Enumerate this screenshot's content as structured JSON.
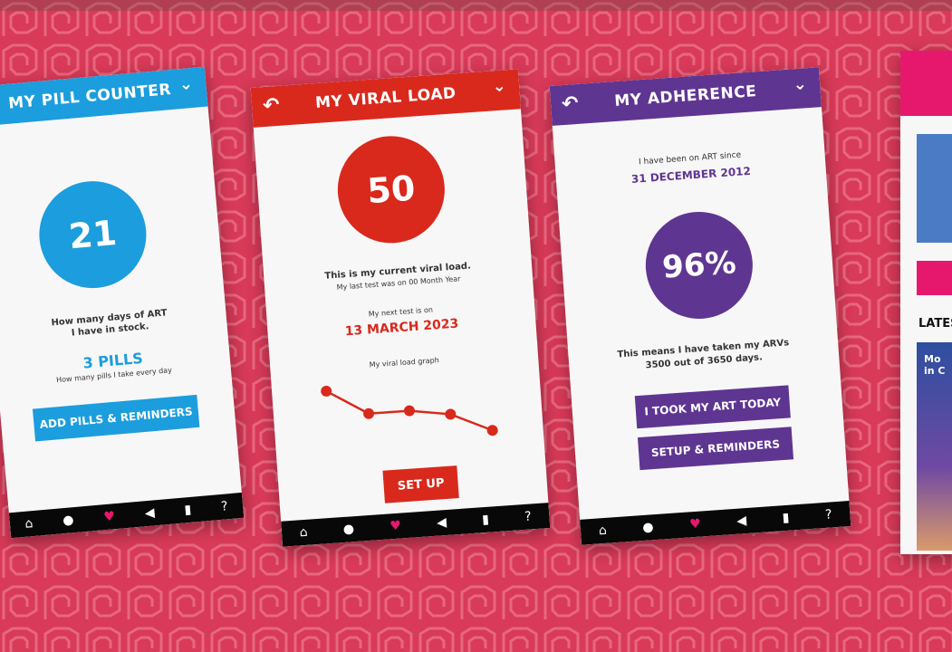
{
  "colors": {
    "background": "#d83a58",
    "pattern": "#e8677e",
    "blue": "#1c9ddd",
    "red": "#d9291c",
    "purple": "#5f3592",
    "nav_highlight": "#e6186e"
  },
  "pill_counter": {
    "title": "MY PILL COUNTER",
    "count": "21",
    "caption_line1": "How many days of ART",
    "caption_line2": "I have in stock.",
    "pills": "3 PILLS",
    "pills_caption": "How many pills I take every day",
    "button": "ADD PILLS & REMINDERS"
  },
  "viral_load": {
    "title": "MY VIRAL LOAD",
    "value": "50",
    "caption_bold": "This is my current viral load.",
    "caption_small": "My last test was on 00 Month Year",
    "next_label": "My next test is on",
    "next_date": "13 MARCH 2023",
    "graph_label": "My viral load graph",
    "graph_values": [
      5,
      3,
      3,
      2.5,
      1
    ],
    "button": "SET UP"
  },
  "adherence": {
    "title": "MY ADHERENCE",
    "since_label": "I have been on ART since",
    "since_date": "31 DECEMBER 2012",
    "percent": "96%",
    "caption_line1": "This means I have taken my ARVs",
    "caption_line2": "3500 out of 3650 days.",
    "button1": "I TOOK MY ART TODAY",
    "button2": "SETUP & REMINDERS"
  },
  "partial_screen": {
    "latest_label": "LATES",
    "card_text_line1": "Mo",
    "card_text_line2": "in C"
  },
  "nav_icons": [
    "home-icon",
    "info-icon",
    "heart-icon",
    "megaphone-icon",
    "map-pin-icon",
    "help-icon"
  ]
}
